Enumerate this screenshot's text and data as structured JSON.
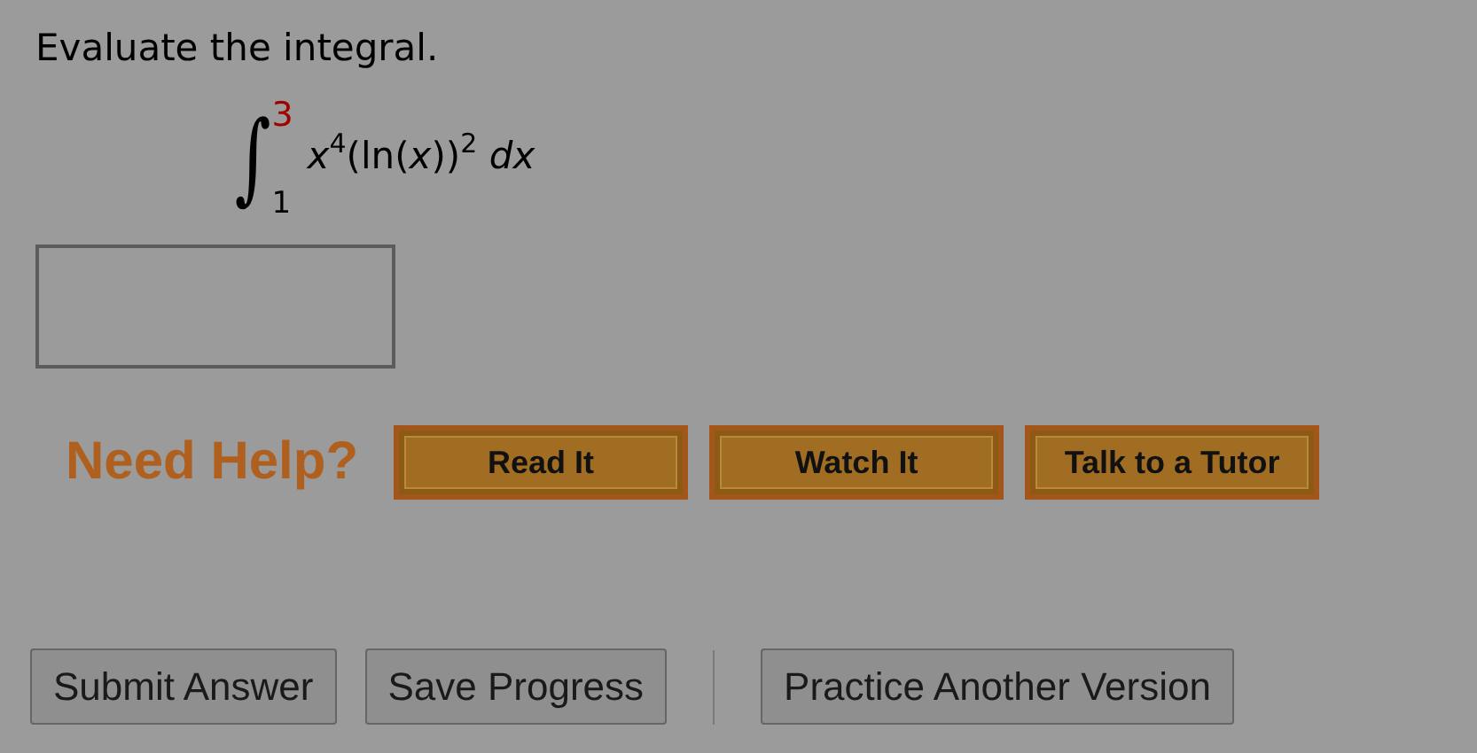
{
  "prompt": "Evaluate the integral.",
  "integral": {
    "sign": "∫",
    "upper": "3",
    "lower": "1",
    "integrand": "*x*$^{4}$(ln(*x*))$^{2}$ *dx*"
  },
  "help": {
    "label": "Need Help?",
    "buttons": [
      "Read It",
      "Watch It",
      "Talk to a Tutor"
    ]
  },
  "actions": [
    {
      "label": "Submit Answer",
      "kind": "button"
    },
    {
      "label": "Save Progress",
      "kind": "button"
    },
    {
      "kind": "divider"
    },
    {
      "label": "Practice Another Version",
      "kind": "button"
    }
  ]
}
